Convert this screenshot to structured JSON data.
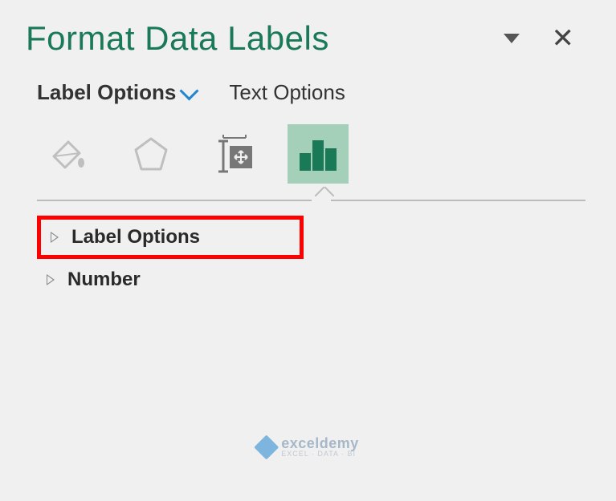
{
  "panel": {
    "title": "Format Data Labels"
  },
  "tabs": {
    "label_options": "Label Options",
    "text_options": "Text Options"
  },
  "icons": {
    "fill_line": "fill-line-icon",
    "effects": "effects-icon",
    "size_properties": "size-properties-icon",
    "label_options": "label-options-chart-icon"
  },
  "sections": {
    "label_options": "Label Options",
    "number": "Number"
  },
  "watermark": {
    "main": "exceldemy",
    "sub": "EXCEL · DATA · BI"
  }
}
